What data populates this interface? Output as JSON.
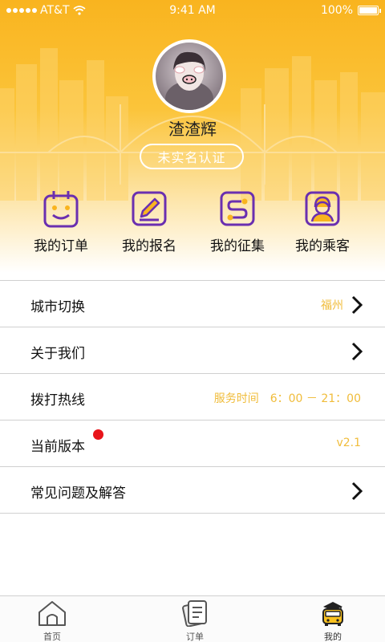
{
  "status_bar": {
    "carrier": "AT&T",
    "time": "9:41 AM",
    "battery": "100%"
  },
  "profile": {
    "username": "渣渣辉",
    "verify_label": "未实名认证"
  },
  "quick_actions": [
    {
      "label": "我的订单",
      "icon": "calendar-smile-icon"
    },
    {
      "label": "我的报名",
      "icon": "edit-pen-icon"
    },
    {
      "label": "我的征集",
      "icon": "route-icon"
    },
    {
      "label": "我的乘客",
      "icon": "passenger-icon"
    }
  ],
  "menu": {
    "city": {
      "label": "城市切换",
      "value": "福州"
    },
    "about": {
      "label": "关于我们"
    },
    "hotline": {
      "label": "拨打热线",
      "value": "服务时间　6：00 － 21：00"
    },
    "version": {
      "label": "当前版本",
      "value": "v2.1"
    },
    "faq": {
      "label": "常见问题及解答"
    }
  },
  "tabs": [
    {
      "label": "首页",
      "icon": "home-icon"
    },
    {
      "label": "订单",
      "icon": "order-list-icon"
    },
    {
      "label": "我的",
      "icon": "bus-mascot-icon"
    }
  ],
  "colors": {
    "accent": "#f9b41f",
    "icon_purple": "#6a2fb0",
    "value_yellow": "#f0bc3a",
    "badge_red": "#e8141a"
  }
}
